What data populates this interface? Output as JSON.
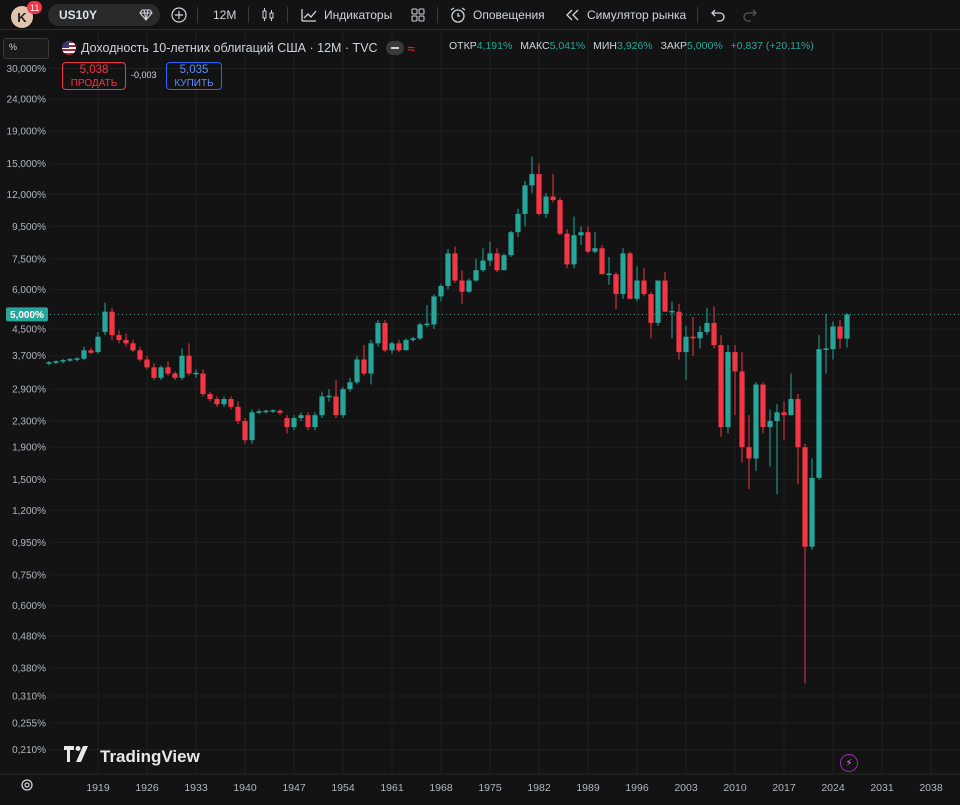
{
  "toolbar": {
    "avatar_letter": "K",
    "notifications": "11",
    "symbol": "US10Y",
    "interval": "12M",
    "indicators": "Индикаторы",
    "alerts": "Оповещения",
    "replay": "Симулятор рынка"
  },
  "scale_mode": "%",
  "legend": {
    "title": "Доходность 10-летних облигаций США · 12М · TVC",
    "open_label": "ОТКР",
    "open": "4,191%",
    "high_label": "МАКС",
    "high": "5,041%",
    "low_label": "МИН",
    "low": "3,926%",
    "close_label": "ЗАКР",
    "close": "5,000%",
    "change": "+0,837 (+20,11%)"
  },
  "trade": {
    "sell_price": "5,038",
    "sell_label": "ПРОДАТЬ",
    "spread": "-0,003",
    "buy_price": "5,035",
    "buy_label": "КУПИТЬ"
  },
  "watermark": "TradingView",
  "colors": {
    "up": "#26a69a",
    "down": "#f23645",
    "bg": "#131313",
    "grid": "#1f1f1f",
    "price_tag": "#26a69a"
  },
  "chart_data": {
    "type": "candlestick",
    "y_scale": "log",
    "current_price_label": "5,000%",
    "current_price": 5.0,
    "x_ticks": [
      "1919",
      "1926",
      "1933",
      "1940",
      "1947",
      "1954",
      "1961",
      "1968",
      "1975",
      "1982",
      "1989",
      "1996",
      "2003",
      "2010",
      "2017",
      "2024",
      "2031",
      "2038"
    ],
    "y_ticks": [
      {
        "label": "30,000%",
        "value": 30.0
      },
      {
        "label": "24,000%",
        "value": 24.0
      },
      {
        "label": "19,000%",
        "value": 19.0
      },
      {
        "label": "15,000%",
        "value": 15.0
      },
      {
        "label": "12,000%",
        "value": 12.0
      },
      {
        "label": "9,500%",
        "value": 9.5
      },
      {
        "label": "7,500%",
        "value": 7.5
      },
      {
        "label": "6,000%",
        "value": 6.0
      },
      {
        "label": "4,500%",
        "value": 4.5
      },
      {
        "label": "3,700%",
        "value": 3.7
      },
      {
        "label": "2,900%",
        "value": 2.9
      },
      {
        "label": "2,300%",
        "value": 2.3
      },
      {
        "label": "1,900%",
        "value": 1.9
      },
      {
        "label": "1,500%",
        "value": 1.5
      },
      {
        "label": "1,200%",
        "value": 1.2
      },
      {
        "label": "0,950%",
        "value": 0.95
      },
      {
        "label": "0,750%",
        "value": 0.75
      },
      {
        "label": "0,600%",
        "value": 0.6
      },
      {
        "label": "0,480%",
        "value": 0.48
      },
      {
        "label": "0,380%",
        "value": 0.38
      },
      {
        "label": "0,310%",
        "value": 0.31
      },
      {
        "label": "0,255%",
        "value": 0.255
      },
      {
        "label": "0,210%",
        "value": 0.21
      }
    ],
    "candles": [
      {
        "x": 1912,
        "o": 3.5,
        "h": 3.56,
        "l": 3.45,
        "c": 3.52
      },
      {
        "x": 1913,
        "o": 3.52,
        "h": 3.58,
        "l": 3.48,
        "c": 3.55
      },
      {
        "x": 1914,
        "o": 3.55,
        "h": 3.62,
        "l": 3.5,
        "c": 3.58
      },
      {
        "x": 1915,
        "o": 3.58,
        "h": 3.64,
        "l": 3.54,
        "c": 3.6
      },
      {
        "x": 1916,
        "o": 3.6,
        "h": 3.66,
        "l": 3.55,
        "c": 3.62
      },
      {
        "x": 1917,
        "o": 3.62,
        "h": 3.95,
        "l": 3.58,
        "c": 3.85
      },
      {
        "x": 1918,
        "o": 3.85,
        "h": 3.92,
        "l": 3.75,
        "c": 3.78
      },
      {
        "x": 1919,
        "o": 3.8,
        "h": 4.4,
        "l": 3.75,
        "c": 4.25
      },
      {
        "x": 1920,
        "o": 4.4,
        "h": 5.45,
        "l": 4.3,
        "c": 5.1
      },
      {
        "x": 1921,
        "o": 5.1,
        "h": 5.25,
        "l": 4.15,
        "c": 4.3
      },
      {
        "x": 1922,
        "o": 4.3,
        "h": 4.45,
        "l": 4.05,
        "c": 4.15
      },
      {
        "x": 1923,
        "o": 4.15,
        "h": 4.35,
        "l": 3.95,
        "c": 4.05
      },
      {
        "x": 1924,
        "o": 4.05,
        "h": 4.15,
        "l": 3.8,
        "c": 3.85
      },
      {
        "x": 1925,
        "o": 3.85,
        "h": 3.95,
        "l": 3.55,
        "c": 3.6
      },
      {
        "x": 1926,
        "o": 3.6,
        "h": 3.7,
        "l": 3.35,
        "c": 3.4
      },
      {
        "x": 1927,
        "o": 3.4,
        "h": 3.5,
        "l": 3.1,
        "c": 3.15
      },
      {
        "x": 1928,
        "o": 3.15,
        "h": 3.45,
        "l": 3.1,
        "c": 3.4
      },
      {
        "x": 1929,
        "o": 3.4,
        "h": 3.55,
        "l": 3.2,
        "c": 3.25
      },
      {
        "x": 1930,
        "o": 3.25,
        "h": 3.3,
        "l": 3.1,
        "c": 3.15
      },
      {
        "x": 1931,
        "o": 3.15,
        "h": 3.9,
        "l": 3.1,
        "c": 3.7
      },
      {
        "x": 1932,
        "o": 3.7,
        "h": 4.05,
        "l": 3.2,
        "c": 3.25
      },
      {
        "x": 1933,
        "o": 3.25,
        "h": 3.35,
        "l": 3.15,
        "c": 3.25
      },
      {
        "x": 1934,
        "o": 3.25,
        "h": 3.35,
        "l": 2.75,
        "c": 2.8
      },
      {
        "x": 1935,
        "o": 2.8,
        "h": 2.85,
        "l": 2.65,
        "c": 2.7
      },
      {
        "x": 1936,
        "o": 2.7,
        "h": 2.75,
        "l": 2.55,
        "c": 2.6
      },
      {
        "x": 1937,
        "o": 2.6,
        "h": 2.75,
        "l": 2.55,
        "c": 2.7
      },
      {
        "x": 1938,
        "o": 2.7,
        "h": 2.75,
        "l": 2.5,
        "c": 2.55
      },
      {
        "x": 1939,
        "o": 2.55,
        "h": 2.65,
        "l": 2.25,
        "c": 2.3
      },
      {
        "x": 1940,
        "o": 2.3,
        "h": 2.35,
        "l": 1.95,
        "c": 2.0
      },
      {
        "x": 1941,
        "o": 2.0,
        "h": 2.5,
        "l": 1.95,
        "c": 2.45
      },
      {
        "x": 1942,
        "o": 2.45,
        "h": 2.5,
        "l": 2.42,
        "c": 2.46
      },
      {
        "x": 1943,
        "o": 2.46,
        "h": 2.5,
        "l": 2.43,
        "c": 2.47
      },
      {
        "x": 1944,
        "o": 2.47,
        "h": 2.5,
        "l": 2.44,
        "c": 2.48
      },
      {
        "x": 1945,
        "o": 2.48,
        "h": 2.5,
        "l": 2.4,
        "c": 2.44
      },
      {
        "x": 1946,
        "o": 2.35,
        "h": 2.4,
        "l": 2.1,
        "c": 2.2
      },
      {
        "x": 1947,
        "o": 2.2,
        "h": 2.4,
        "l": 2.15,
        "c": 2.35
      },
      {
        "x": 1948,
        "o": 2.35,
        "h": 2.45,
        "l": 2.3,
        "c": 2.4
      },
      {
        "x": 1949,
        "o": 2.4,
        "h": 2.45,
        "l": 2.15,
        "c": 2.2
      },
      {
        "x": 1950,
        "o": 2.2,
        "h": 2.45,
        "l": 2.15,
        "c": 2.4
      },
      {
        "x": 1951,
        "o": 2.4,
        "h": 2.85,
        "l": 2.35,
        "c": 2.75
      },
      {
        "x": 1952,
        "o": 2.75,
        "h": 2.9,
        "l": 2.65,
        "c": 2.75
      },
      {
        "x": 1953,
        "o": 2.75,
        "h": 3.1,
        "l": 2.35,
        "c": 2.4
      },
      {
        "x": 1954,
        "o": 2.4,
        "h": 2.95,
        "l": 2.35,
        "c": 2.9
      },
      {
        "x": 1955,
        "o": 2.9,
        "h": 3.15,
        "l": 2.85,
        "c": 3.05
      },
      {
        "x": 1956,
        "o": 3.05,
        "h": 3.7,
        "l": 3.0,
        "c": 3.6
      },
      {
        "x": 1957,
        "o": 3.6,
        "h": 4.0,
        "l": 3.2,
        "c": 3.25
      },
      {
        "x": 1958,
        "o": 3.25,
        "h": 4.15,
        "l": 3.0,
        "c": 4.05
      },
      {
        "x": 1959,
        "o": 4.05,
        "h": 4.8,
        "l": 3.95,
        "c": 4.7
      },
      {
        "x": 1960,
        "o": 4.7,
        "h": 4.8,
        "l": 3.8,
        "c": 3.85
      },
      {
        "x": 1961,
        "o": 3.85,
        "h": 4.1,
        "l": 3.75,
        "c": 4.05
      },
      {
        "x": 1962,
        "o": 4.05,
        "h": 4.15,
        "l": 3.8,
        "c": 3.85
      },
      {
        "x": 1963,
        "o": 3.85,
        "h": 4.2,
        "l": 3.85,
        "c": 4.15
      },
      {
        "x": 1964,
        "o": 4.15,
        "h": 4.25,
        "l": 4.1,
        "c": 4.2
      },
      {
        "x": 1965,
        "o": 4.2,
        "h": 4.7,
        "l": 4.15,
        "c": 4.65
      },
      {
        "x": 1966,
        "o": 4.65,
        "h": 5.35,
        "l": 4.55,
        "c": 4.65
      },
      {
        "x": 1967,
        "o": 4.65,
        "h": 5.8,
        "l": 4.5,
        "c": 5.7
      },
      {
        "x": 1968,
        "o": 5.7,
        "h": 6.25,
        "l": 5.5,
        "c": 6.15
      },
      {
        "x": 1969,
        "o": 6.15,
        "h": 8.05,
        "l": 6.0,
        "c": 7.8
      },
      {
        "x": 1970,
        "o": 7.8,
        "h": 8.2,
        "l": 6.3,
        "c": 6.4
      },
      {
        "x": 1971,
        "o": 6.4,
        "h": 6.9,
        "l": 5.4,
        "c": 5.9
      },
      {
        "x": 1972,
        "o": 5.9,
        "h": 6.5,
        "l": 5.85,
        "c": 6.4
      },
      {
        "x": 1973,
        "o": 6.4,
        "h": 7.5,
        "l": 6.35,
        "c": 6.9
      },
      {
        "x": 1974,
        "o": 6.9,
        "h": 8.1,
        "l": 6.8,
        "c": 7.4
      },
      {
        "x": 1975,
        "o": 7.4,
        "h": 8.5,
        "l": 7.1,
        "c": 7.8
      },
      {
        "x": 1976,
        "o": 7.8,
        "h": 8.1,
        "l": 6.8,
        "c": 6.9
      },
      {
        "x": 1977,
        "o": 6.9,
        "h": 7.8,
        "l": 6.9,
        "c": 7.7
      },
      {
        "x": 1978,
        "o": 7.7,
        "h": 9.2,
        "l": 7.6,
        "c": 9.1
      },
      {
        "x": 1979,
        "o": 9.1,
        "h": 10.8,
        "l": 8.8,
        "c": 10.4
      },
      {
        "x": 1980,
        "o": 10.4,
        "h": 13.2,
        "l": 9.5,
        "c": 12.8
      },
      {
        "x": 1981,
        "o": 12.8,
        "h": 15.8,
        "l": 12.1,
        "c": 13.9
      },
      {
        "x": 1982,
        "o": 13.9,
        "h": 15.0,
        "l": 10.3,
        "c": 10.4
      },
      {
        "x": 1983,
        "o": 10.4,
        "h": 12.1,
        "l": 10.1,
        "c": 11.8
      },
      {
        "x": 1984,
        "o": 11.8,
        "h": 13.9,
        "l": 11.3,
        "c": 11.5
      },
      {
        "x": 1985,
        "o": 11.5,
        "h": 11.7,
        "l": 8.9,
        "c": 9.0
      },
      {
        "x": 1986,
        "o": 9.0,
        "h": 9.3,
        "l": 7.0,
        "c": 7.2
      },
      {
        "x": 1987,
        "o": 7.2,
        "h": 10.2,
        "l": 7.0,
        "c": 8.9
      },
      {
        "x": 1988,
        "o": 8.9,
        "h": 9.5,
        "l": 8.3,
        "c": 9.1
      },
      {
        "x": 1989,
        "o": 9.1,
        "h": 9.5,
        "l": 7.8,
        "c": 7.9
      },
      {
        "x": 1990,
        "o": 7.9,
        "h": 9.1,
        "l": 7.8,
        "c": 8.1
      },
      {
        "x": 1991,
        "o": 8.1,
        "h": 8.3,
        "l": 6.7,
        "c": 6.7
      },
      {
        "x": 1992,
        "o": 6.7,
        "h": 7.6,
        "l": 6.2,
        "c": 6.7
      },
      {
        "x": 1993,
        "o": 6.7,
        "h": 6.8,
        "l": 5.2,
        "c": 5.8
      },
      {
        "x": 1994,
        "o": 5.8,
        "h": 8.1,
        "l": 5.6,
        "c": 7.8
      },
      {
        "x": 1995,
        "o": 7.8,
        "h": 7.9,
        "l": 5.6,
        "c": 5.6
      },
      {
        "x": 1996,
        "o": 5.6,
        "h": 7.1,
        "l": 5.5,
        "c": 6.4
      },
      {
        "x": 1997,
        "o": 6.4,
        "h": 7.0,
        "l": 5.7,
        "c": 5.8
      },
      {
        "x": 1998,
        "o": 5.8,
        "h": 5.9,
        "l": 4.2,
        "c": 4.7
      },
      {
        "x": 1999,
        "o": 4.7,
        "h": 6.4,
        "l": 4.6,
        "c": 6.4
      },
      {
        "x": 2000,
        "o": 6.4,
        "h": 6.8,
        "l": 5.1,
        "c": 5.1
      },
      {
        "x": 2001,
        "o": 5.1,
        "h": 5.5,
        "l": 4.2,
        "c": 5.1
      },
      {
        "x": 2002,
        "o": 5.1,
        "h": 5.4,
        "l": 3.6,
        "c": 3.8
      },
      {
        "x": 2003,
        "o": 3.8,
        "h": 4.6,
        "l": 3.1,
        "c": 4.25
      },
      {
        "x": 2004,
        "o": 4.25,
        "h": 4.9,
        "l": 3.7,
        "c": 4.2
      },
      {
        "x": 2005,
        "o": 4.2,
        "h": 4.6,
        "l": 3.9,
        "c": 4.4
      },
      {
        "x": 2006,
        "o": 4.4,
        "h": 5.25,
        "l": 4.3,
        "c": 4.7
      },
      {
        "x": 2007,
        "o": 4.7,
        "h": 5.3,
        "l": 3.9,
        "c": 4.0
      },
      {
        "x": 2008,
        "o": 4.0,
        "h": 4.3,
        "l": 2.05,
        "c": 2.2
      },
      {
        "x": 2009,
        "o": 2.2,
        "h": 4.0,
        "l": 2.1,
        "c": 3.8
      },
      {
        "x": 2010,
        "o": 3.8,
        "h": 4.0,
        "l": 2.4,
        "c": 3.3
      },
      {
        "x": 2011,
        "o": 3.3,
        "h": 3.8,
        "l": 1.7,
        "c": 1.9
      },
      {
        "x": 2012,
        "o": 1.9,
        "h": 2.4,
        "l": 1.4,
        "c": 1.75
      },
      {
        "x": 2013,
        "o": 1.75,
        "h": 3.05,
        "l": 1.6,
        "c": 3.0
      },
      {
        "x": 2014,
        "o": 3.0,
        "h": 3.05,
        "l": 2.1,
        "c": 2.2
      },
      {
        "x": 2015,
        "o": 2.2,
        "h": 2.5,
        "l": 1.65,
        "c": 2.3
      },
      {
        "x": 2016,
        "o": 2.3,
        "h": 2.6,
        "l": 1.35,
        "c": 2.45
      },
      {
        "x": 2017,
        "o": 2.45,
        "h": 2.65,
        "l": 2.0,
        "c": 2.4
      },
      {
        "x": 2018,
        "o": 2.4,
        "h": 3.25,
        "l": 2.4,
        "c": 2.7
      },
      {
        "x": 2019,
        "o": 2.7,
        "h": 2.8,
        "l": 1.45,
        "c": 1.9
      },
      {
        "x": 2020,
        "o": 1.9,
        "h": 1.95,
        "l": 0.34,
        "c": 0.92
      },
      {
        "x": 2021,
        "o": 0.92,
        "h": 1.75,
        "l": 0.9,
        "c": 1.52
      },
      {
        "x": 2022,
        "o": 1.52,
        "h": 4.3,
        "l": 1.5,
        "c": 3.88
      },
      {
        "x": 2023,
        "o": 3.88,
        "h": 5.02,
        "l": 3.25,
        "c": 3.88
      },
      {
        "x": 2024,
        "o": 3.88,
        "h": 4.75,
        "l": 3.6,
        "c": 4.58
      },
      {
        "x": 2025,
        "o": 4.58,
        "h": 4.8,
        "l": 3.9,
        "c": 4.19
      },
      {
        "x": 2026,
        "o": 4.19,
        "h": 5.04,
        "l": 3.93,
        "c": 5.0
      }
    ]
  }
}
